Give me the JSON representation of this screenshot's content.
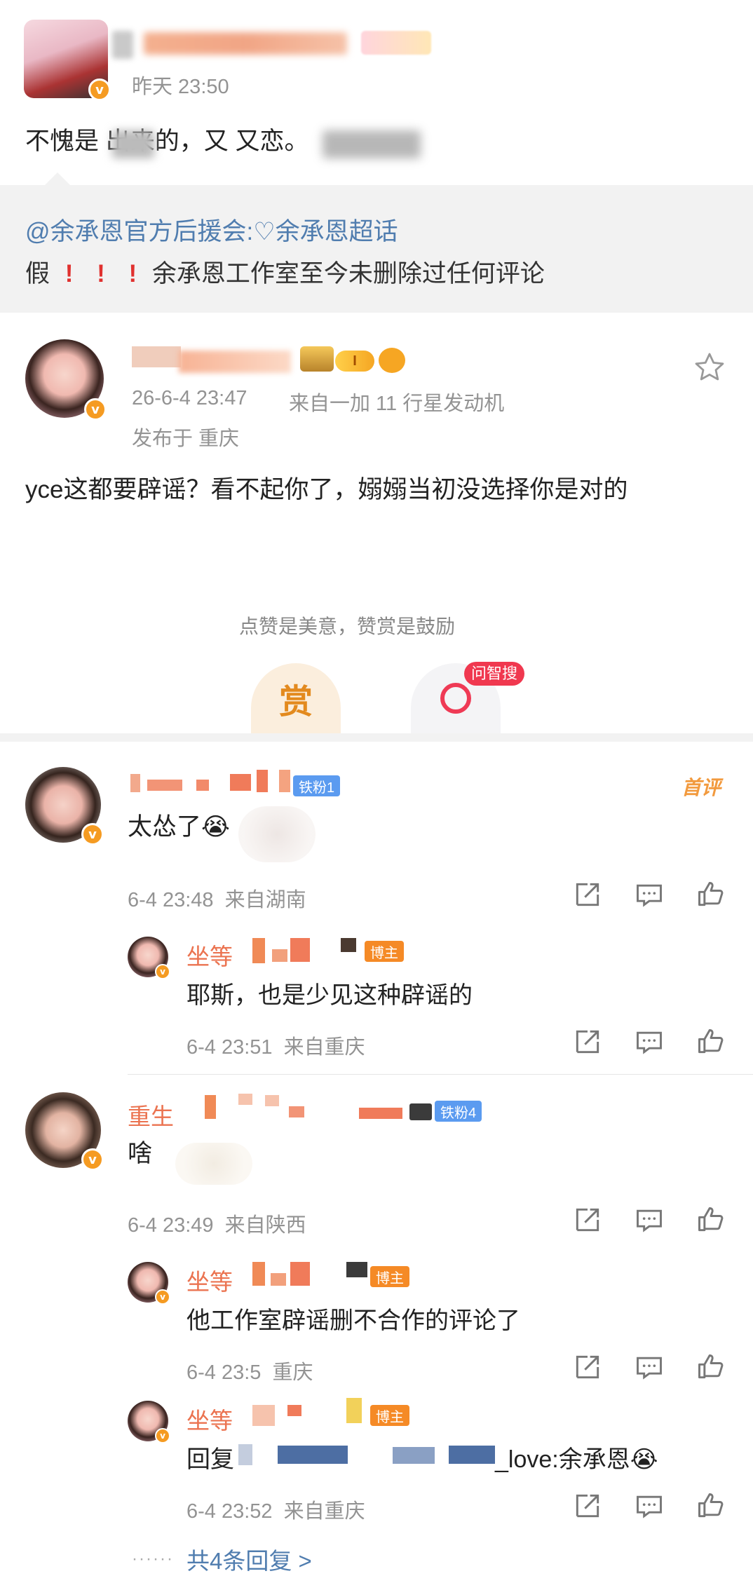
{
  "top_post": {
    "timestamp": "昨天 23:50",
    "text": "不愧是  出来的，又  又恋。"
  },
  "quote": {
    "line1": "@余承恩官方后援会:♡余承恩超话",
    "line2_prefix": "假",
    "line2_rest": "余承恩工作室至今未删除过任何评论"
  },
  "main_post": {
    "timestamp": "26-6-4 23:47",
    "source": "来自一加 11 行星发动机",
    "location": "发布于 重庆",
    "text": "yce这都要辟谣？看不起你了，嫋嫋当初没选择你是对的",
    "reward_hint": "点赞是美意，赞赏是鼓励",
    "reward_label": "赏",
    "ask_label": "问智搜"
  },
  "comments": [
    {
      "badge": "铁粉1",
      "first_label": "首评",
      "text": "太怂了😭",
      "meta": "6-4 23:48  来自湖南",
      "replies": [
        {
          "name": "坐等",
          "badge": "博主",
          "text": "耶斯，也是少见这种辟谣的",
          "meta": "6-4 23:51  来自重庆"
        }
      ]
    },
    {
      "name": "重生",
      "badge": "铁粉4",
      "text": "啥",
      "meta": "6-4 23:49  来自陕西",
      "replies": [
        {
          "name": "坐等",
          "badge": "博主",
          "text": "他工作室辟谣删不合作的评论了",
          "meta": "6-4 23:5  重庆"
        },
        {
          "name": "坐等",
          "badge": "博主",
          "text_prefix": "回复",
          "text_suffix": "_love:余承恩😭",
          "meta": "6-4 23:52  来自重庆"
        }
      ],
      "more_replies": "共4条回复 >"
    }
  ],
  "colors": {
    "accent": "#eb7350",
    "meta": "#939393",
    "link": "#507daf",
    "quote_bg": "#f2f2f2"
  }
}
